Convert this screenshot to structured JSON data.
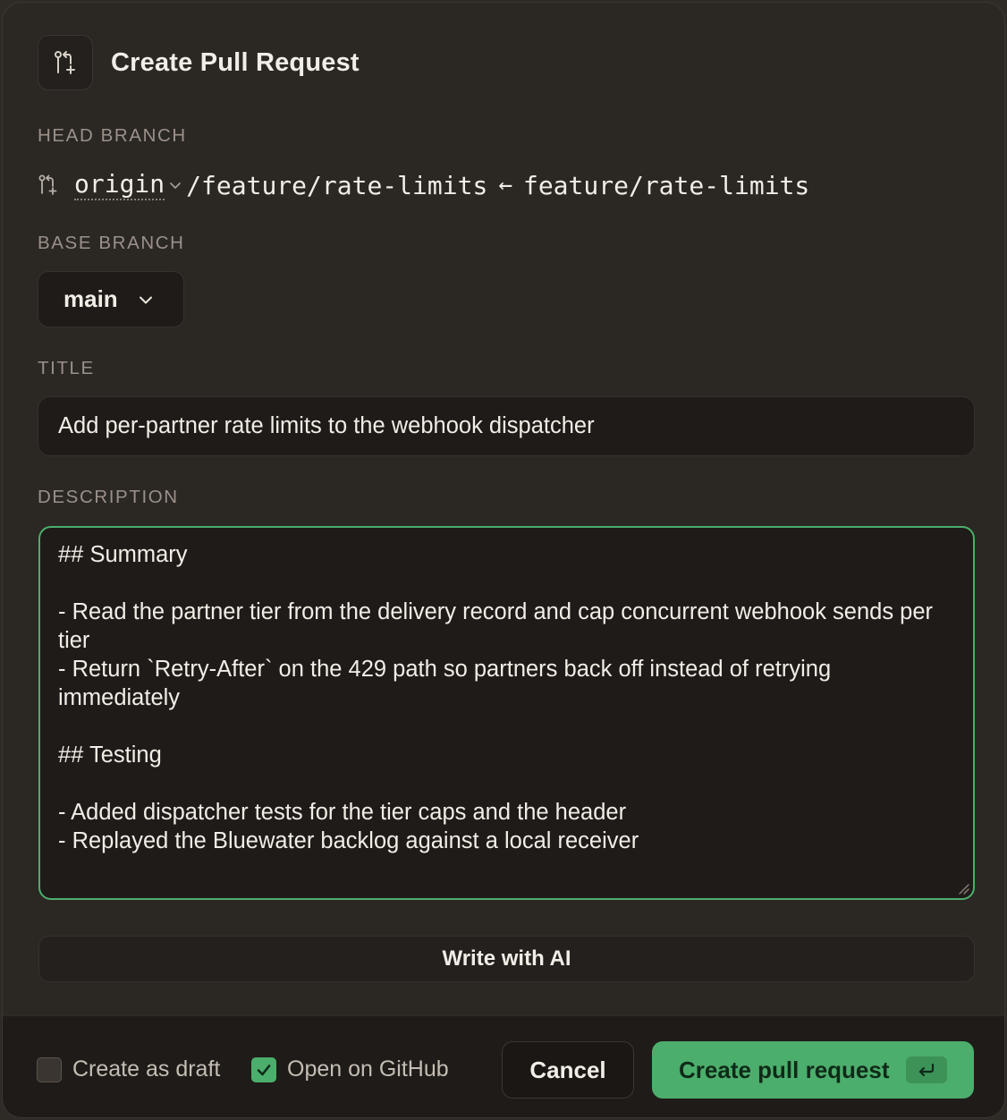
{
  "dialog": {
    "title": "Create Pull Request"
  },
  "head_branch": {
    "label": "HEAD BRANCH",
    "remote": "origin",
    "remote_branch": "/feature/rate-limits",
    "arrow": "←",
    "local_branch": "feature/rate-limits"
  },
  "base_branch": {
    "label": "BASE BRANCH",
    "value": "main"
  },
  "title_field": {
    "label": "TITLE",
    "value": "Add per-partner rate limits to the webhook dispatcher"
  },
  "description": {
    "label": "DESCRIPTION",
    "lines": [
      "## Summary",
      "",
      "- Read the partner tier from the delivery record and cap concurrent webhook sends per tier",
      "- Return `Retry-After` on the 429 path so partners back off instead of retrying immediately",
      "",
      "## Testing",
      "",
      "- Added dispatcher tests for the tier caps and the header",
      "- Replayed the Bluewater backlog against a local receiver"
    ]
  },
  "ai_button": {
    "label": "Write with AI"
  },
  "footer": {
    "draft_checkbox": {
      "label": "Create as draft",
      "checked": false
    },
    "github_checkbox": {
      "label": "Open on GitHub",
      "checked": true
    },
    "cancel_label": "Cancel",
    "create_label": "Create pull request"
  },
  "colors": {
    "accent": "#4cae6c",
    "background": "#2b2723",
    "field_background": "#1f1b18"
  },
  "icons": {
    "header": "git-pull-request-create-icon",
    "head_branch": "git-pull-request-icon",
    "chevron": "chevron-down-icon",
    "enter": "enter-key-icon",
    "check": "checkmark-icon"
  }
}
